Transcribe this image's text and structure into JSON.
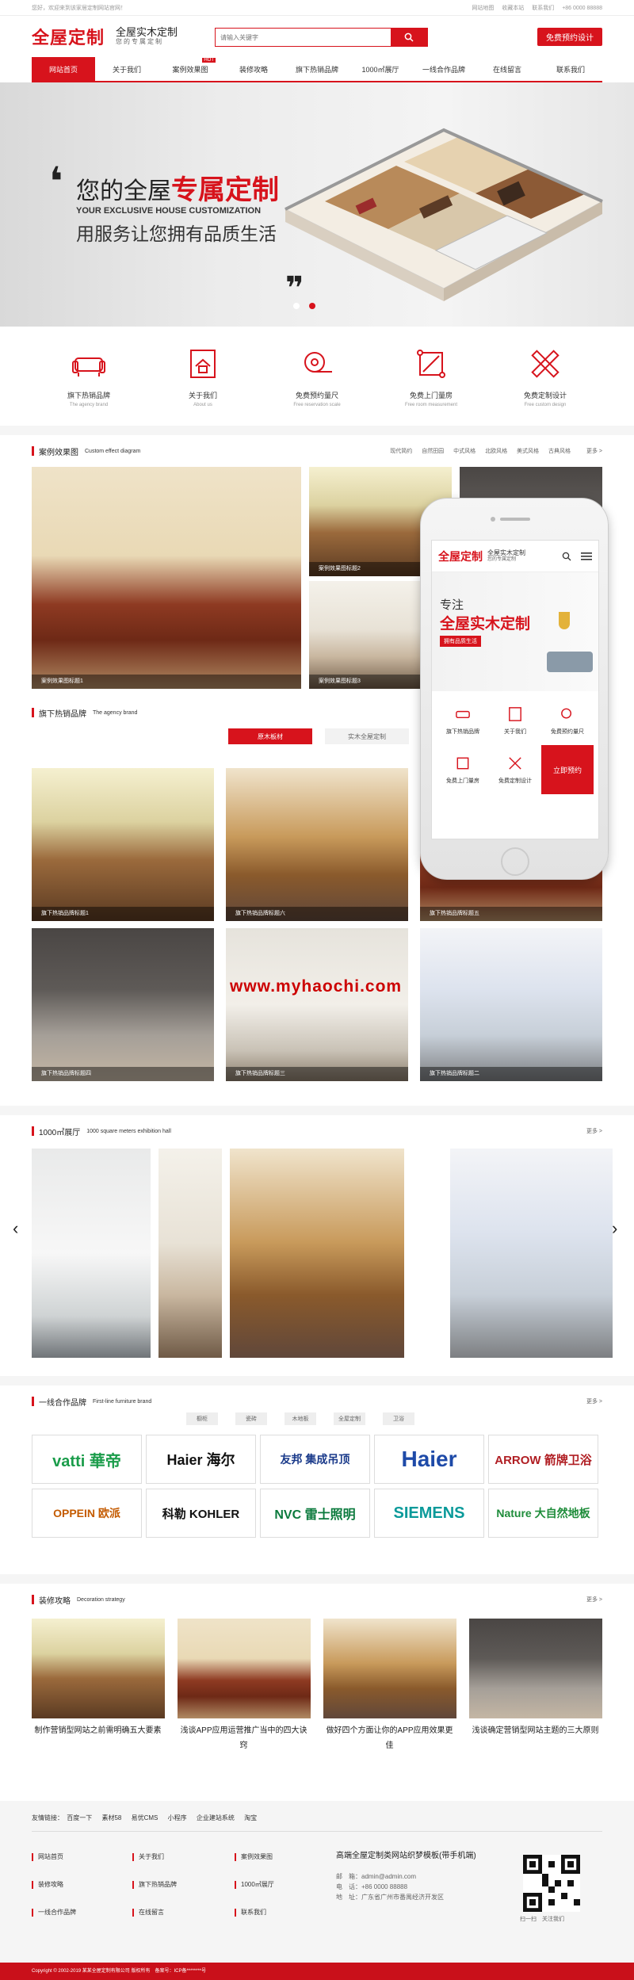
{
  "topbar": {
    "welcome": "您好，欢迎来到该家居定制网站官网！",
    "links": [
      "网站地图",
      "收藏本站",
      "联系我们"
    ],
    "tel_label": "+86 0000 88888"
  },
  "header": {
    "logo": "全屋定制",
    "slogan": "全屋实木定制",
    "slogan_sub": "您的专属定制",
    "search_placeholder": "请输入关键字",
    "cta": "免费预约设计"
  },
  "nav": {
    "items": [
      "网站首页",
      "关于我们",
      "案例效果图",
      "装修攻略",
      "旗下热销品牌",
      "1000㎡展厅",
      "一线合作品牌",
      "在线留言",
      "联系我们"
    ],
    "hot": "HOT"
  },
  "banner": {
    "line1_pre": "您的全屋",
    "line1_em": "专属定制",
    "line2": "YOUR EXCLUSIVE HOUSE CUSTOMIZATION",
    "line3": "用服务让您拥有品质生活"
  },
  "services": [
    {
      "cn": "旗下热销品牌",
      "en": "The agency brand",
      "icon": "sofa-icon"
    },
    {
      "cn": "关于我们",
      "en": "About us",
      "icon": "house-doc-icon"
    },
    {
      "cn": "免费预约量尺",
      "en": "Free reservation scale",
      "icon": "tape-measure-icon"
    },
    {
      "cn": "免费上门量房",
      "en": "Free room measurement",
      "icon": "measure-frame-icon"
    },
    {
      "cn": "免费定制设计",
      "en": "Free custom design",
      "icon": "pencil-ruler-icon"
    }
  ],
  "cases": {
    "title": "案例效果图",
    "en": "Custom effect diagram",
    "tags": [
      "现代简约",
      "自然田园",
      "中式风格",
      "北欧风格",
      "美式风格",
      "古典风格"
    ],
    "more": "更多 >",
    "captions": [
      "案例效果图标题1",
      "案例效果图标题2",
      "案例效果图标题3"
    ]
  },
  "brands_hot": {
    "title": "旗下热销品牌",
    "en": "The agency brand",
    "tabs": [
      "原木板材",
      "实木全屋定制"
    ],
    "captions": [
      "旗下热销品牌标题1",
      "旗下热销品牌标题六",
      "旗下热销品牌标题五",
      "旗下热销品牌标题四",
      "旗下热销品牌标题三",
      "旗下热销品牌标题二"
    ]
  },
  "watermark": "www.myhaochi.com",
  "showroom": {
    "title": "1000㎡展厅",
    "en": "1000 square meters exhibition hall",
    "more": "更多 >"
  },
  "partners": {
    "title": "一线合作品牌",
    "en": "First-line furniture brand",
    "more": "更多 >",
    "tabs": [
      "橱柜",
      "瓷砖",
      "木地板",
      "全屋定制",
      "卫浴"
    ],
    "logos": [
      "vatti 華帝",
      "Haier 海尔",
      "友邦 集成吊顶",
      "Haier",
      "ARROW 箭牌卫浴",
      "OPPEIN 欧派",
      "科勒 KOHLER",
      "NVC 雷士照明",
      "SIEMENS",
      "Nature 大自然地板"
    ]
  },
  "guide": {
    "title": "装修攻略",
    "en": "Decoration strategy",
    "more": "更多 >",
    "items": [
      "制作营销型网站之前需明确五大要素",
      "浅谈APP应用运营推广当中的四大诀窍",
      "做好四个方面让你的APP应用效果更佳",
      "浅谈确定营销型网站主题的三大原则"
    ]
  },
  "phone": {
    "logo": "全屋定制",
    "slogan": "全屋实木定制",
    "slogan_sub": "您的专属定制",
    "banner_small": "专注",
    "banner_big": "全屋实木定制",
    "banner_tag": "拥有品质生活",
    "grid": [
      "旗下热销品牌",
      "关于我们",
      "免费预约量尺",
      "免费上门量房",
      "免费定制设计"
    ],
    "cta": "立即预约"
  },
  "footer": {
    "friend_label": "友情链接：",
    "friends": [
      "百度一下",
      "素材58",
      "易优CMS",
      "小程序",
      "企业建站系统",
      "淘宝"
    ],
    "links": [
      "网站首页",
      "关于我们",
      "案例效果图",
      "装修攻略",
      "旗下热销品牌",
      "1000㎡展厅",
      "一线合作品牌",
      "在线留言",
      "联系我们"
    ],
    "contact_title": "高端全屋定制类网站织梦模板(带手机端)",
    "email": "邮　箱：admin@admin.com",
    "tel": "电　话：+86 0000 88888",
    "addr": "地　址：广东省广州市番禺经济开发区",
    "qr_label": "扫一扫　关注我们",
    "copyright": "Copyright © 2002-2019 某某全屋定制有限公司 版权所有　备案号：ICP备********号"
  },
  "colors": {
    "accent": "#d7131c"
  }
}
